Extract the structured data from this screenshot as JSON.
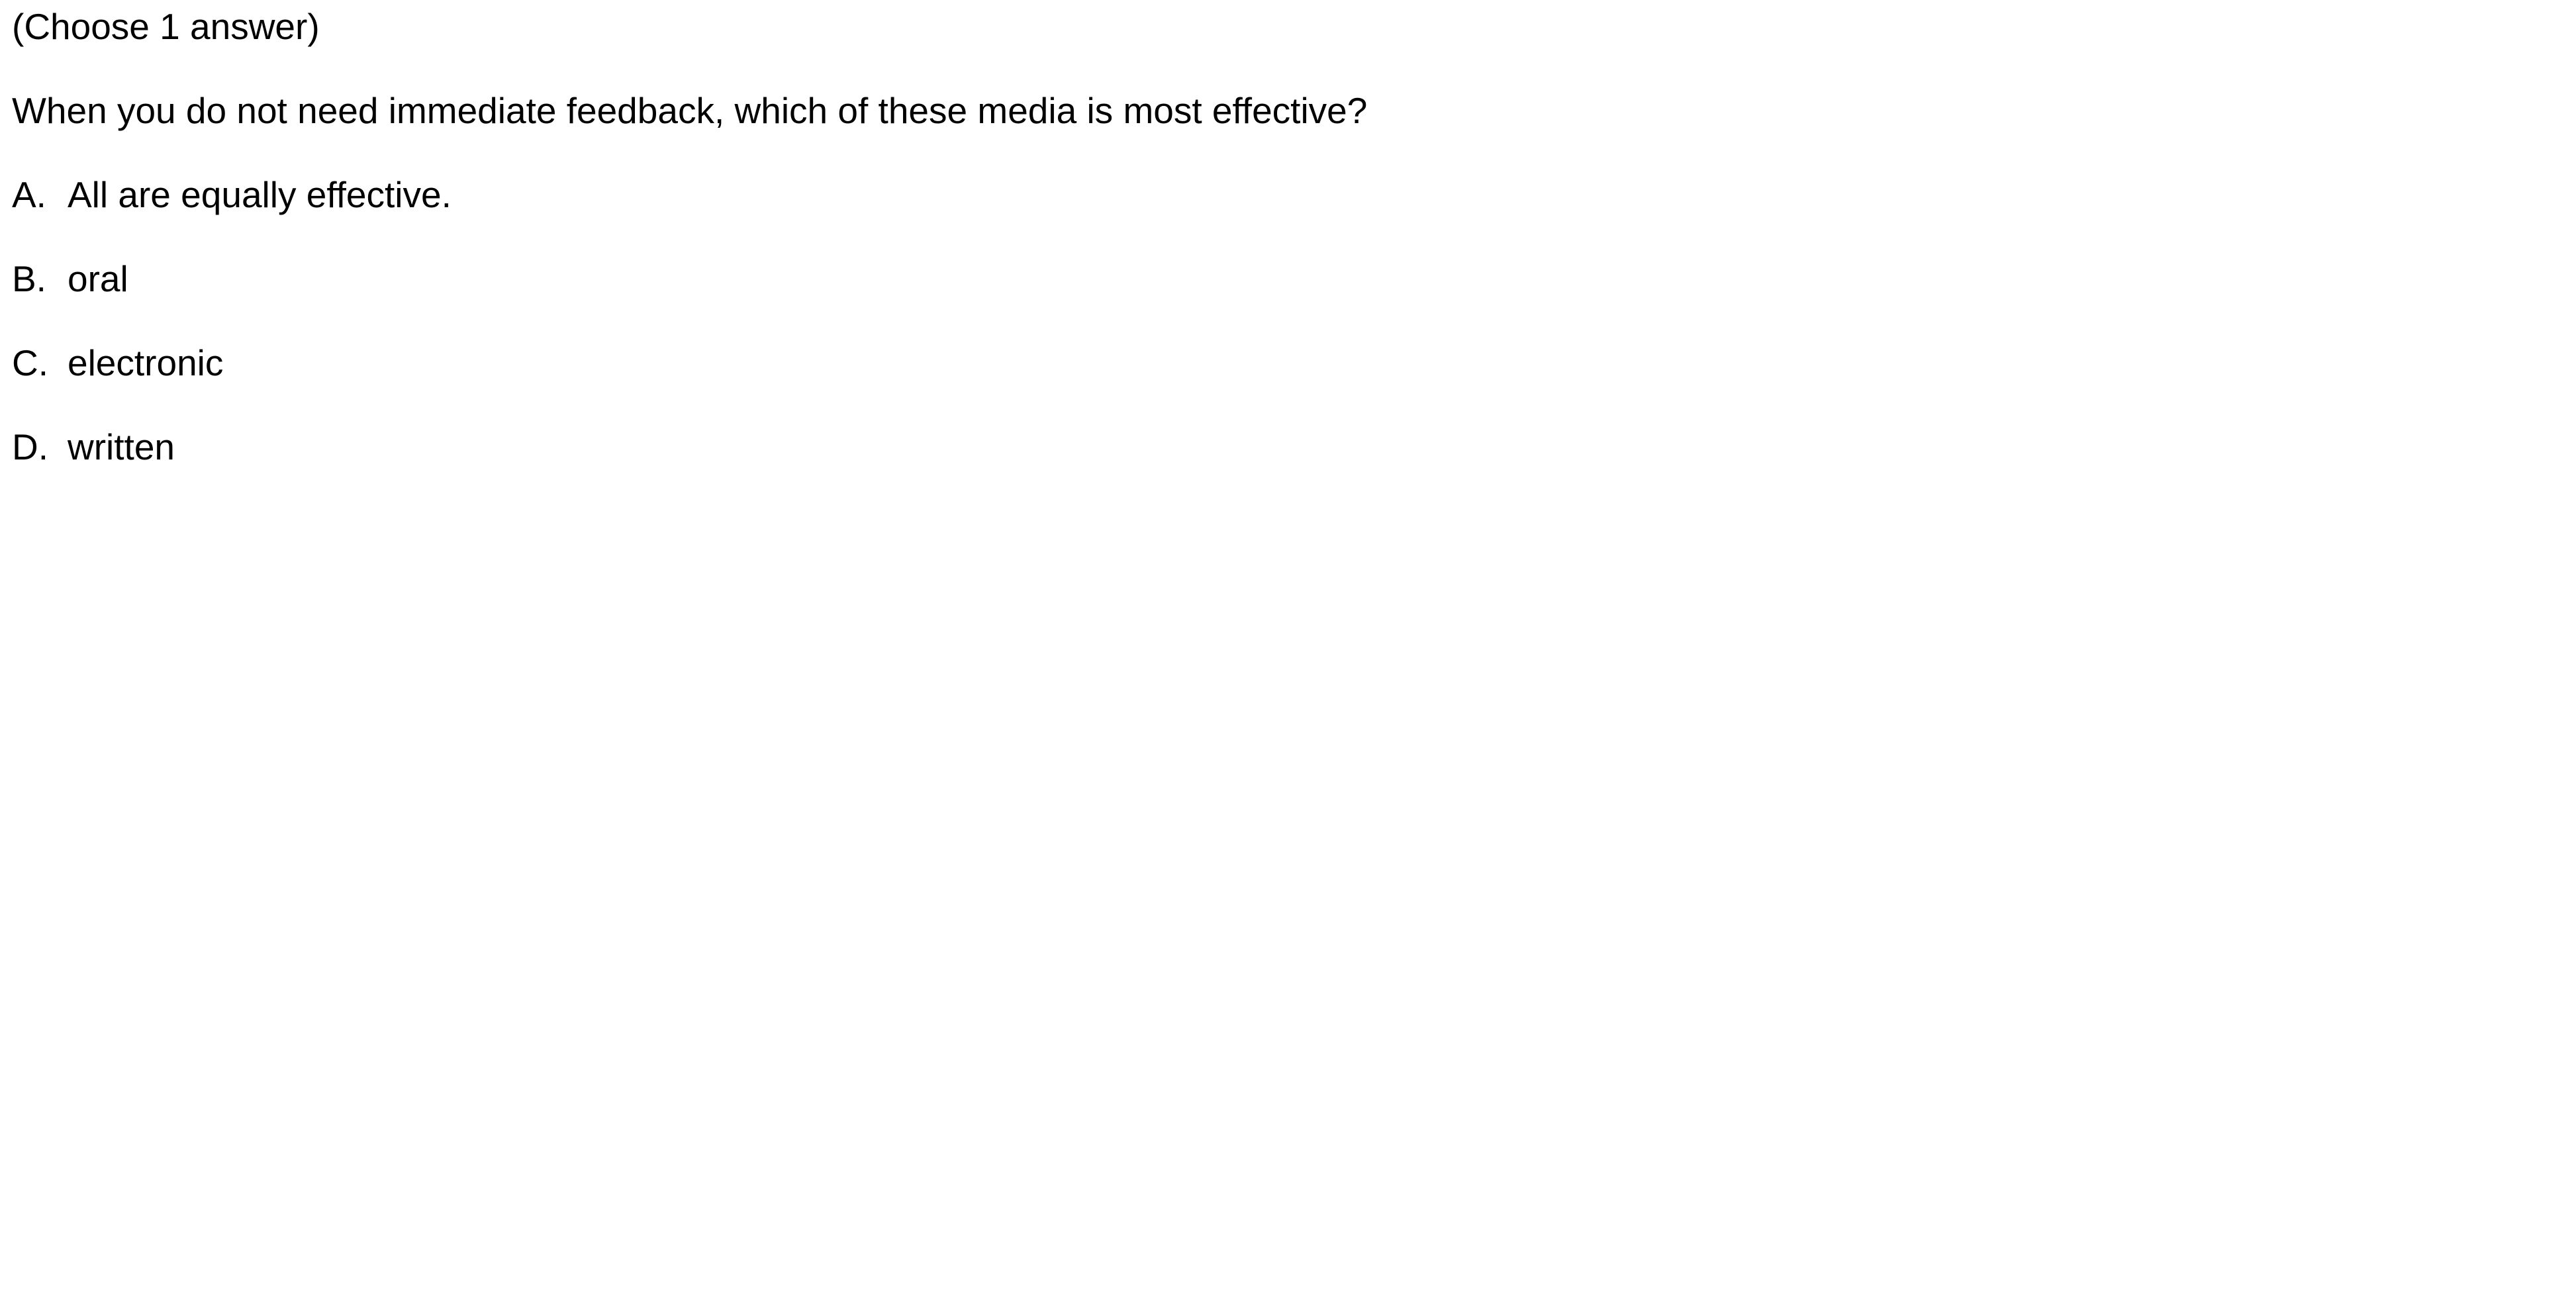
{
  "quiz": {
    "instruction": "(Choose 1 answer)",
    "question": "When you do not need immediate feedback, which of these media is most effective?",
    "choices": [
      {
        "letter": "A.",
        "text": "All are equally effective."
      },
      {
        "letter": "B.",
        "text": "oral"
      },
      {
        "letter": "C.",
        "text": "electronic"
      },
      {
        "letter": "D.",
        "text": "written"
      }
    ]
  }
}
